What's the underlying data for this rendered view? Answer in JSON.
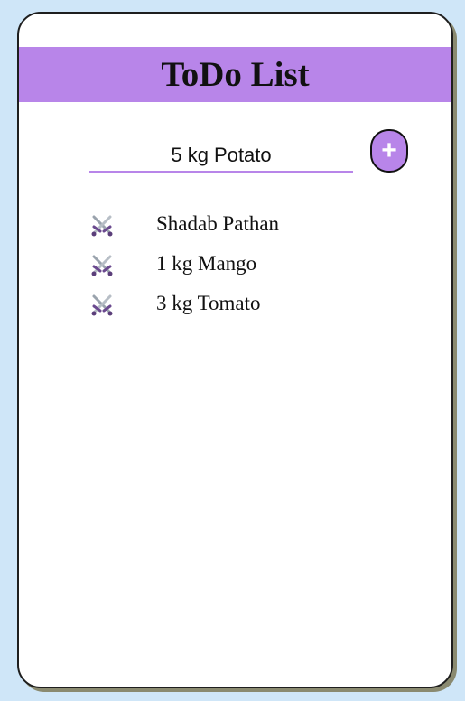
{
  "app": {
    "title": "ToDo List"
  },
  "input": {
    "value": "5 kg Potato",
    "placeholder": ""
  },
  "add_button": {
    "label": "+"
  },
  "items": [
    {
      "text": "Shadab Pathan",
      "delete_icon": "crossed-swords-icon"
    },
    {
      "text": "1 kg Mango",
      "delete_icon": "crossed-swords-icon"
    },
    {
      "text": "3 kg Tomato",
      "delete_icon": "crossed-swords-icon"
    }
  ],
  "colors": {
    "accent": "#b885e9",
    "page_background": "#cfe6f8",
    "card_background": "#ffffff",
    "text": "#111111"
  }
}
